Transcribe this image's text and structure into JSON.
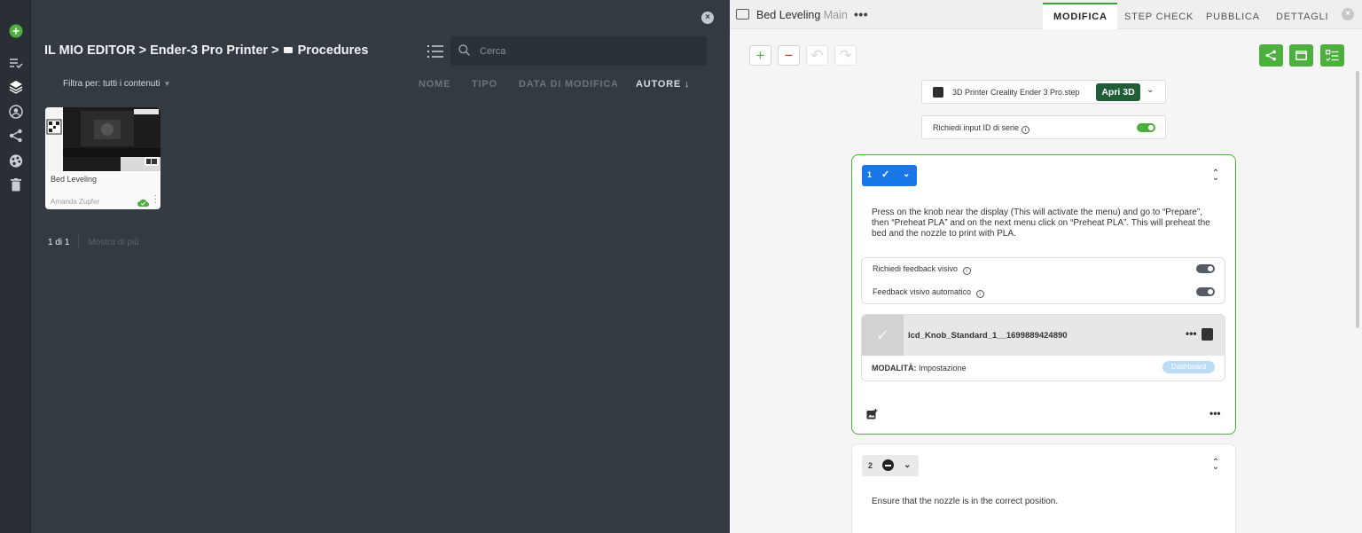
{
  "rail": {
    "icons": [
      "add-circle-icon",
      "checklist-icon",
      "layers-icon",
      "user-circle-icon",
      "share-icon",
      "palette-icon",
      "trash-icon"
    ]
  },
  "library": {
    "breadcrumb": {
      "root": "IL MIO EDITOR",
      "sep": ">",
      "project": "Ender-3 Pro Printer",
      "folder": "Procedures"
    },
    "search_placeholder": "Cerca",
    "filter_label": "Filtra per: tutti i contenuti",
    "columns": {
      "name": "NOME",
      "type": "TIPO",
      "modified": "DATA DI MODIFICA",
      "author": "AUTORE",
      "author_sort": "↓"
    },
    "card": {
      "title": "Bed Leveling",
      "author": "Amanda Zupfer"
    },
    "pager": {
      "count": "1 di 1",
      "more": "Mostra di più"
    },
    "close_symbol": "×"
  },
  "editor": {
    "title": "Bed Leveling",
    "branch": "Main",
    "title_menu": "•••",
    "tabs": [
      "MODIFICA",
      "STEP CHECK",
      "PUBBLICA",
      "DETTAGLI"
    ],
    "active_tab": 0,
    "close_symbol": "×",
    "toolbar": {
      "add": "+",
      "remove": "−",
      "undo": "↶",
      "redo": "↷"
    },
    "file": {
      "name": "3D Printer Creality Ender 3 Pro.step",
      "open_label": "Apri 3D",
      "chevron": "⌄"
    },
    "serial": {
      "label": "Richiedi input ID di serie",
      "enabled": true
    },
    "steps": [
      {
        "number": "1",
        "description": "Press on the knob near the display (This will activate the menu) and go to “Prepare”, then “Preheat PLA” and on the next menu click on “Preheat PLA”. This will preheat the bed and the nozzle to print with PLA.",
        "visual_feedback_label": "Richiedi feedback visivo",
        "visual_feedback": false,
        "auto_feedback_label": "Feedback visivo automatico",
        "auto_feedback": false,
        "media_name": "lcd_Knob_Standard_1__1699889424890",
        "mode_label": "MODALITÀ:",
        "mode_value": "Impostazione",
        "mode_badge": "Dashboard",
        "menu": "•••"
      },
      {
        "number": "2",
        "description": "Ensure that the nozzle is in the correct position."
      }
    ],
    "colors": {
      "accent": "#4caf3e",
      "step_blue": "#1976e6",
      "open3d": "#1f5e36"
    }
  }
}
